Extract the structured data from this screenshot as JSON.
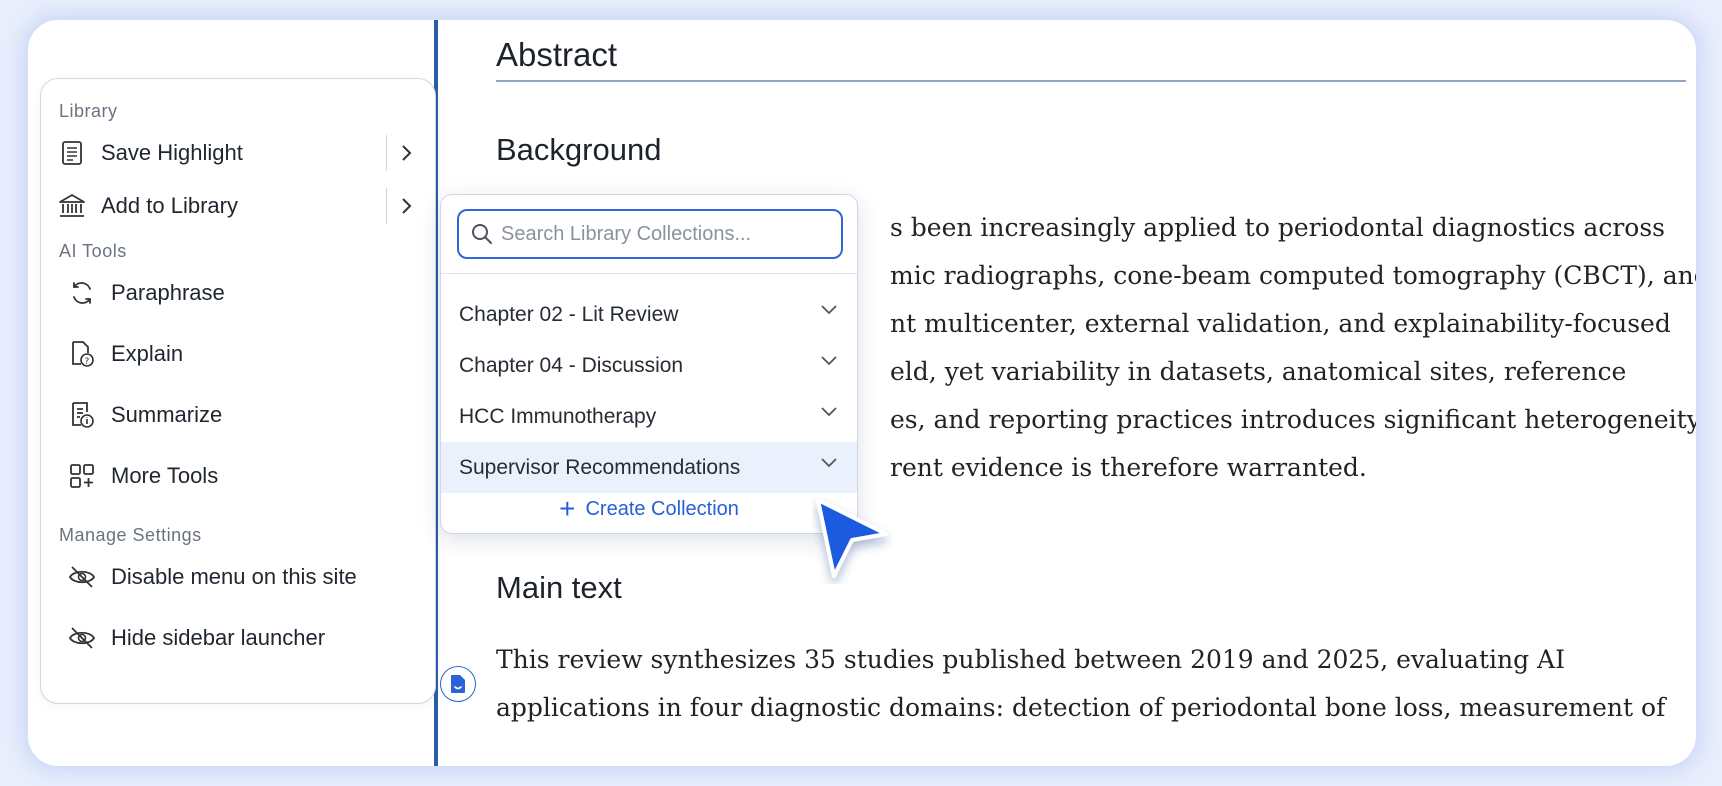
{
  "menu": {
    "sections": {
      "library": "Library",
      "ai_tools": "AI Tools",
      "manage": "Manage Settings"
    },
    "items": {
      "save_highlight": "Save Highlight",
      "add_library": "Add to Library",
      "paraphrase": "Paraphrase",
      "explain": "Explain",
      "summarize": "Summarize",
      "more_tools": "More Tools",
      "disable_menu": "Disable menu on this site",
      "hide_launcher": "Hide sidebar launcher"
    }
  },
  "popover": {
    "search_placeholder": "Search Library Collections...",
    "collections": [
      "Chapter 02 - Lit Review",
      "Chapter 04 - Discussion",
      "HCC Immunotherapy",
      "Supervisor Recommendations"
    ],
    "create_label": "Create Collection"
  },
  "document": {
    "abstract": "Abstract",
    "background": "Background",
    "background_lines": [
      "s been increasingly applied to periodontal diagnostics across",
      "mic radiographs, cone-beam computed tomography (CBCT), and",
      "nt multicenter, external validation, and explainability-focused",
      "eld, yet variability in datasets, anatomical sites, reference",
      "es, and reporting practices introduces significant heterogeneity.",
      "rent evidence is therefore warranted."
    ],
    "main_text": "Main text",
    "main_lines": [
      "This review synthesizes 35 studies published between 2019 and 2025, evaluating AI",
      "applications in four diagnostic domains: detection of periodontal bone loss, measurement of"
    ]
  },
  "colors": {
    "accent": "#2f66da",
    "divider": "#2a5ca8",
    "selected_row": "#eaf1fd"
  }
}
